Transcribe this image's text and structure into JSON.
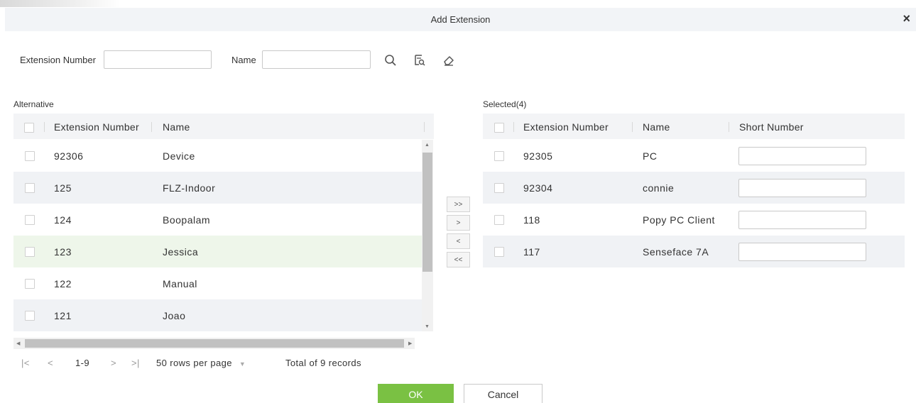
{
  "dialog": {
    "title": "Add Extension",
    "close_glyph": "×"
  },
  "search": {
    "extension_label": "Extension Number",
    "extension_value": "",
    "name_label": "Name",
    "name_value": "",
    "icons": [
      "search-icon",
      "query-history-icon",
      "eraser-icon"
    ]
  },
  "alternative": {
    "label": "Alternative",
    "columns": [
      "Extension Number",
      "Name"
    ],
    "rows": [
      {
        "ext": "92306",
        "name": "Device"
      },
      {
        "ext": "125",
        "name": "FLZ-Indoor"
      },
      {
        "ext": "124",
        "name": "Boopalam"
      },
      {
        "ext": "123",
        "name": "Jessica"
      },
      {
        "ext": "122",
        "name": "Manual"
      },
      {
        "ext": "121",
        "name": "Joao"
      }
    ],
    "highlight_color": "#eef6ea"
  },
  "transfer": {
    "all_right": ">>",
    "right": ">",
    "left": "<",
    "all_left": "<<"
  },
  "selected": {
    "label": "Selected(4)",
    "columns": [
      "Extension Number",
      "Name",
      "Short Number"
    ],
    "rows": [
      {
        "ext": "92305",
        "name": "PC",
        "short": ""
      },
      {
        "ext": "92304",
        "name": "connie",
        "short": ""
      },
      {
        "ext": "118",
        "name": "Popy PC Client",
        "short": ""
      },
      {
        "ext": "117",
        "name": "Senseface 7A",
        "short": ""
      }
    ]
  },
  "pagination": {
    "first": "|<",
    "prev": "<",
    "range": "1-9",
    "next": ">",
    "last": ">|",
    "rows_per_page": "50 rows per page",
    "total": "Total of 9 records"
  },
  "footer": {
    "ok": "OK",
    "cancel": "Cancel",
    "ok_color": "#7ac143"
  }
}
